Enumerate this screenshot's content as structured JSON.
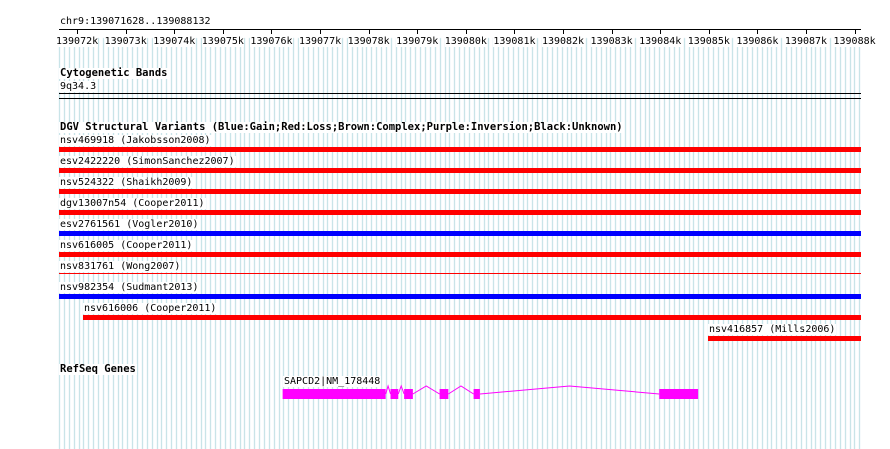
{
  "ruler": {
    "location": "chr9:139071628..139088132",
    "start": 139071628,
    "end": 139088132,
    "tick_labels": [
      "139072k",
      "139073k",
      "139074k",
      "139075k",
      "139076k",
      "139077k",
      "139078k",
      "139079k",
      "139080k",
      "139081k",
      "139082k",
      "139083k",
      "139084k",
      "139085k",
      "139086k",
      "139087k",
      "139088k"
    ],
    "tick_positions": [
      139072000,
      139073000,
      139074000,
      139075000,
      139076000,
      139077000,
      139078000,
      139079000,
      139080000,
      139081000,
      139082000,
      139083000,
      139084000,
      139085000,
      139086000,
      139087000,
      139088000
    ]
  },
  "cytoband": {
    "title": "Cytogenetic Bands",
    "band": "9q34.3"
  },
  "dgv": {
    "title": "DGV Structural Variants (Blue:Gain;Red:Loss;Brown:Complex;Purple:Inversion;Black:Unknown)",
    "variants": [
      {
        "label": "nsv469918 (Jakobsson2008)",
        "color": "#ff0000",
        "start": 139071628,
        "end": 139088132
      },
      {
        "label": "esv2422220 (SimonSanchez2007)",
        "color": "#ff0000",
        "start": 139071628,
        "end": 139088132
      },
      {
        "label": "nsv524322 (Shaikh2009)",
        "color": "#ff0000",
        "start": 139071628,
        "end": 139088132
      },
      {
        "label": "dgv13007n54 (Cooper2011)",
        "color": "#ff0000",
        "start": 139071628,
        "end": 139088132
      },
      {
        "label": "esv2761561 (Vogler2010)",
        "color": "#0000ff",
        "start": 139071628,
        "end": 139088132
      },
      {
        "label": "nsv616005 (Cooper2011)",
        "color": "#ff0000",
        "start": 139071628,
        "end": 139088132
      },
      {
        "label": "nsv831761 (Wong2007)",
        "color": "#ff0000",
        "start": 139071628,
        "end": 139088132
      },
      {
        "label": "nsv982354 (Sudmant2013)",
        "color": "#0000ff",
        "start": 139071628,
        "end": 139088132
      },
      {
        "label": "nsv616006 (Cooper2011)",
        "color": "#ff0000",
        "start": 139072130,
        "end": 139088132
      },
      {
        "label": "nsv416857 (Mills2006)",
        "color": "#ff0000",
        "start": 139084980,
        "end": 139088132
      }
    ]
  },
  "refseq": {
    "title": "RefSeq Genes",
    "gene_label": "SAPCD2|NM_178448",
    "color": "#ff00ff",
    "start": 139076230,
    "end": 139084780,
    "exons": [
      [
        139076230,
        139078350
      ],
      [
        139078450,
        139078610
      ],
      [
        139078730,
        139078910
      ],
      [
        139079460,
        139079640
      ],
      [
        139080160,
        139080290
      ],
      [
        139083980,
        139084780
      ]
    ]
  }
}
